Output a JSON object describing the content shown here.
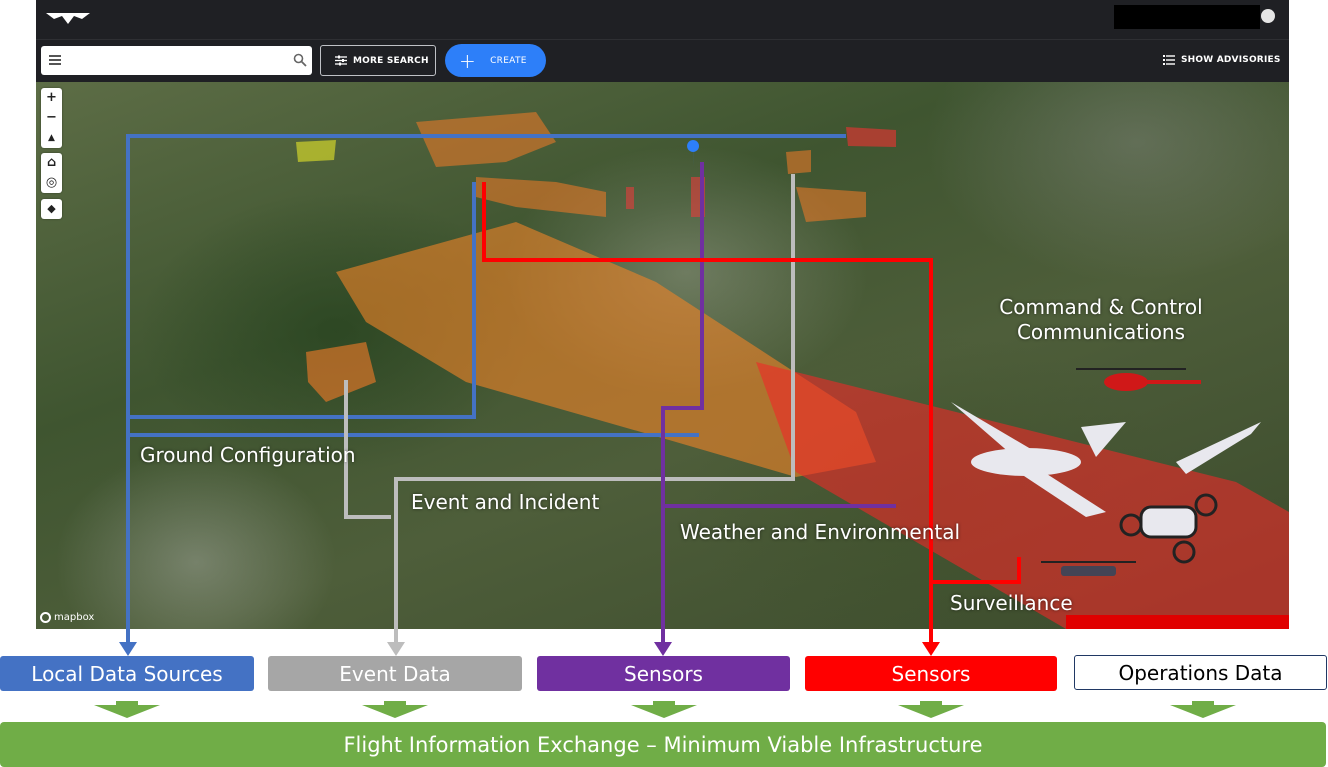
{
  "toolbar": {
    "search_placeholder": "",
    "more_search_label": "MORE SEARCH",
    "create_label": "CREATE",
    "advisories_label": "SHOW ADVISORIES"
  },
  "map": {
    "controls": [
      "+",
      "−",
      "▲",
      "⌂",
      "◎",
      "◆"
    ],
    "attribution": "mapbox"
  },
  "overlay_labels": {
    "command_control_line1": "Command & Control",
    "command_control_line2": "Communications",
    "ground_configuration": "Ground Configuration",
    "event_incident": "Event and Incident",
    "weather_environmental": "Weather and Environmental",
    "surveillance": "Surveillance"
  },
  "sources": {
    "local_data": "Local Data Sources",
    "event_data": "Event Data",
    "sensors_purple": "Sensors",
    "sensors_red": "Sensors",
    "operations_data": "Operations Data"
  },
  "banner": "Flight Information Exchange – Minimum Viable Infrastructure",
  "colors": {
    "blue": "#4472c4",
    "gray": "#a6a6a6",
    "purple": "#7030a0",
    "red": "#ff0000",
    "green": "#70ad47",
    "create_blue": "#2d7ff9"
  }
}
